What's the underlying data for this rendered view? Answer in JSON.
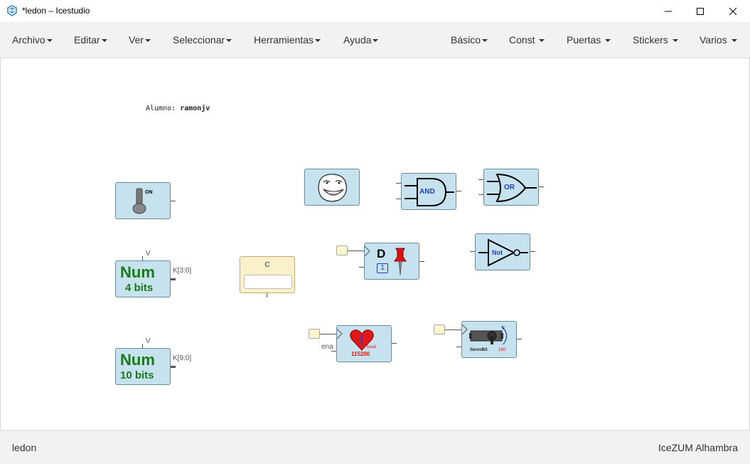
{
  "window": {
    "title": "*ledon – Icestudio"
  },
  "menus": {
    "left": [
      "Archivo",
      "Editar",
      "Ver",
      "Seleccionar",
      "Herramientas",
      "Ayuda"
    ],
    "right": [
      "Básico",
      "Const",
      "Puertas",
      "Stickers",
      "Varios"
    ]
  },
  "canvas": {
    "memo_label": "Alumno:",
    "memo_value": "ramonjv",
    "switch_label": "ON",
    "num4": {
      "top_label": "V",
      "port": "K[3:0]",
      "line1": "Num",
      "line2": "4 bits"
    },
    "num10": {
      "top_label": "V",
      "port": "K[9:0]",
      "line1": "Num",
      "line2": "10 bits"
    },
    "info_title": "C",
    "and_label": "AND",
    "or_label": "OR",
    "not_label": "Not",
    "dff": {
      "letter": "D",
      "value": "1"
    },
    "heart": {
      "side_label": "ena",
      "unit": "baud",
      "value": "115200"
    },
    "servo": {
      "name": "ServoBit",
      "angle": "180"
    }
  },
  "status": {
    "project": "ledon",
    "board": "IceZUM Alhambra"
  },
  "colors": {
    "block_fill": "#c7e2ef",
    "block_border": "#6d8a99",
    "info_fill": "#fbf0cc",
    "num_green": "#1a7a1a"
  }
}
